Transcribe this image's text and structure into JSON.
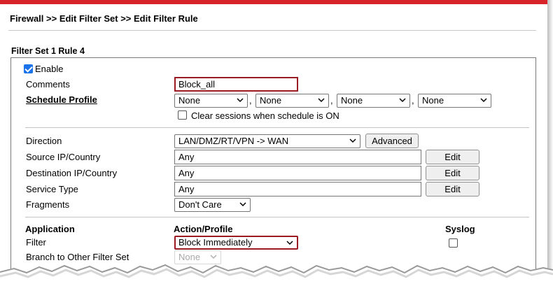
{
  "breadcrumb": "Firewall >> Edit Filter Set >> Edit Filter Rule",
  "filter_title": "Filter Set 1 Rule 4",
  "enable": {
    "label": "Enable",
    "checked": true
  },
  "comments": {
    "label": "Comments",
    "value": "Block_all"
  },
  "schedule": {
    "label": "Schedule Profile",
    "profiles": [
      "None",
      "None",
      "None",
      "None"
    ],
    "separator": ",",
    "clear_sessions_label": "Clear sessions when schedule is ON"
  },
  "direction": {
    "label": "Direction",
    "value": "LAN/DMZ/RT/VPN -> WAN",
    "advanced_label": "Advanced"
  },
  "source": {
    "label": "Source IP/Country",
    "value": "Any",
    "edit_label": "Edit"
  },
  "destination": {
    "label": "Destination IP/Country",
    "value": "Any",
    "edit_label": "Edit"
  },
  "service": {
    "label": "Service Type",
    "value": "Any",
    "edit_label": "Edit"
  },
  "fragments": {
    "label": "Fragments",
    "value": "Don't Care"
  },
  "headers": {
    "application": "Application",
    "action": "Action/Profile",
    "syslog": "Syslog"
  },
  "filter": {
    "label": "Filter",
    "value": "Block Immediately"
  },
  "branch": {
    "label": "Branch to Other Filter Set",
    "value": "None"
  },
  "colors": {
    "accent_red": "#d9232a",
    "highlight_border": "#9b1b24",
    "checkbox_blue": "#1a73e8"
  },
  "icons": {
    "select_arrow": "chevron-down-icon",
    "checkbox": "checkmark-icon"
  }
}
